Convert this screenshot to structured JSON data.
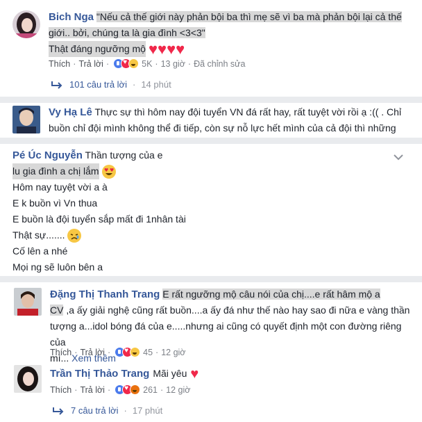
{
  "comment1": {
    "author": "Bich Nga",
    "line1": "\"Nếu cả thế giới này phản bội ba thì mẹ sẽ vì ba mà phản bội lại cả thế",
    "line2": "giới.. bởi, chúng ta là gia đình <3<3\"",
    "line3": "Thật đáng ngưỡng mộ",
    "like": "Thích",
    "reply": "Trả lời",
    "reaction_count": "5K",
    "time": "13 giờ",
    "edited": "Đã chỉnh sửa",
    "replies": "101 câu trả lời",
    "replies_time": "14 phút"
  },
  "comment2": {
    "author": "Vy Hạ Lê",
    "line1": "Thực sự thì hôm nay đội tuyển VN đá rất hay, rất tuyệt vời rồi ạ :(( . Chỉ",
    "line2": "buồn chỉ đội mình không thể đi tiếp, còn sự nỗ lực hết mình của cả đội thì những người"
  },
  "comment3": {
    "author": "Pé Úc Nguyễn",
    "line1": "Thần tượng của e",
    "line2": "lu gia đình a chị lắm",
    "line3": "Hôm nay tuyệt vời a à",
    "line4": "E k buồn vì Vn thua",
    "line5": "E buồn là đội tuyển sắp mất đi 1nhân tài",
    "line6": "Thật sự.......",
    "line7": "Cố lên a nhé",
    "line8": "Mọi ng sẽ luôn bên a"
  },
  "comment4": {
    "author": "Đặng Thị Thanh Trang",
    "line1": "E rất ngưỡng mộ câu nói của chị....e rất hâm mộ a",
    "line2a": "CV",
    "line2b": " ,a ấy giải nghệ cũng rất buồn....a ấy đá như thế nào hay sao đi nữa e vàng thần",
    "line3": "tượng a...idol bóng đá của e.....nhưng ai cũng có quyết định một con đường riêng của",
    "line4": "mì...",
    "see_more": "Xem thêm",
    "like": "Thích",
    "reply": "Trả lời",
    "reaction_count": "45",
    "time": "12 giờ"
  },
  "comment5": {
    "author": "Trần Thị Thảo Trang",
    "text": "Mãi yêu",
    "like": "Thích",
    "reply": "Trả lời",
    "reaction_count": "261",
    "time": "12 giờ",
    "replies": "7 câu trả lời",
    "replies_time": "17 phút"
  },
  "colors": {
    "name": "#365899",
    "highlight": "#d8d8d8",
    "separator": "#e9ebee",
    "heart": "#f0284a"
  }
}
